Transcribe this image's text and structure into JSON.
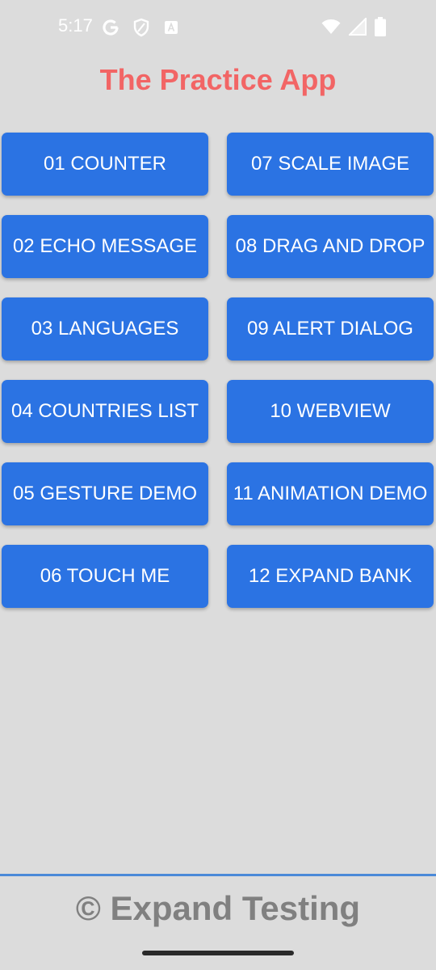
{
  "status_bar": {
    "time": "5:17",
    "icons": [
      "google-g-icon",
      "shield-icon",
      "keyboard-a-icon",
      "wifi-icon",
      "signal-icon",
      "battery-icon"
    ]
  },
  "app": {
    "title": "The Practice App",
    "title_color": "#f26565",
    "button_color": "#2b73e3"
  },
  "buttons": [
    {
      "label": "01 COUNTER"
    },
    {
      "label": "02 ECHO MESSAGE"
    },
    {
      "label": "03 LANGUAGES"
    },
    {
      "label": "04 COUNTRIES LIST"
    },
    {
      "label": "05 GESTURE DEMO"
    },
    {
      "label": "06 TOUCH ME"
    },
    {
      "label": "07 SCALE IMAGE"
    },
    {
      "label": "08 DRAG AND DROP"
    },
    {
      "label": "09 ALERT DIALOG"
    },
    {
      "label": "10 WEBVIEW"
    },
    {
      "label": "11 ANIMATION DEMO"
    },
    {
      "label": "12 EXPAND BANK"
    }
  ],
  "footer": {
    "text": "© Expand Testing",
    "line_color": "#4a89d8"
  }
}
